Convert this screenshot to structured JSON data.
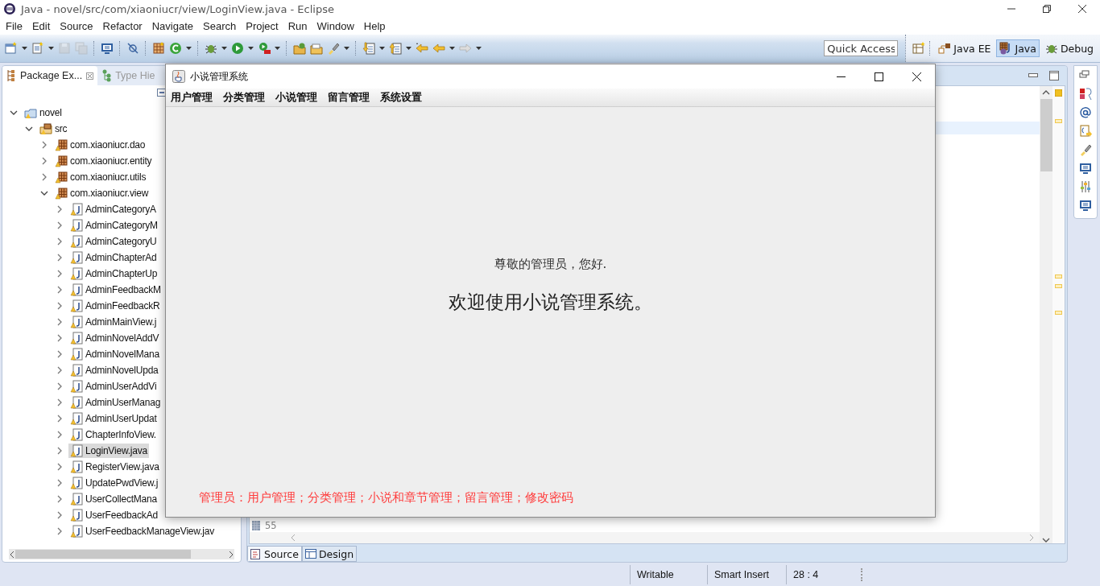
{
  "window": {
    "title": "Java - novel/src/com/xiaoniucr/view/LoginView.java - Eclipse"
  },
  "menu": [
    "File",
    "Edit",
    "Source",
    "Refactor",
    "Navigate",
    "Search",
    "Project",
    "Run",
    "Window",
    "Help"
  ],
  "toolbar": {
    "quick_access": {
      "placeholder": "Quick Access"
    },
    "perspectives": [
      {
        "label": "Java EE",
        "kind": "javaee",
        "selected": false
      },
      {
        "label": "Java",
        "kind": "java",
        "selected": true
      },
      {
        "label": "Debug",
        "kind": "debug",
        "selected": false
      }
    ]
  },
  "package_explorer": {
    "tabs": [
      {
        "label": "Package Ex...",
        "kind": "packages",
        "selected": true
      },
      {
        "label": "Type Hie",
        "kind": "hierarchy",
        "selected": false
      }
    ],
    "tree": [
      {
        "label": "novel",
        "kind": "project",
        "expanded": true,
        "selected": false,
        "children": [
          {
            "label": "src",
            "kind": "source-folder",
            "expanded": true,
            "selected": false,
            "children": [
              {
                "label": "com.xiaoniucr.dao",
                "kind": "package",
                "expanded": false,
                "selected": false
              },
              {
                "label": "com.xiaoniucr.entity",
                "kind": "package",
                "expanded": false,
                "selected": false
              },
              {
                "label": "com.xiaoniucr.utils",
                "kind": "package",
                "expanded": false,
                "selected": false
              },
              {
                "label": "com.xiaoniucr.view",
                "kind": "package",
                "expanded": true,
                "selected": false,
                "children": [
                  {
                    "label": "AdminCategoryA",
                    "kind": "file",
                    "expanded": false,
                    "selected": false
                  },
                  {
                    "label": "AdminCategoryM",
                    "kind": "file",
                    "expanded": false,
                    "selected": false
                  },
                  {
                    "label": "AdminCategoryU",
                    "kind": "file",
                    "expanded": false,
                    "selected": false
                  },
                  {
                    "label": "AdminChapterAd",
                    "kind": "file",
                    "expanded": false,
                    "selected": false
                  },
                  {
                    "label": "AdminChapterUp",
                    "kind": "file",
                    "expanded": false,
                    "selected": false
                  },
                  {
                    "label": "AdminFeedbackM",
                    "kind": "file",
                    "expanded": false,
                    "selected": false
                  },
                  {
                    "label": "AdminFeedbackR",
                    "kind": "file",
                    "expanded": false,
                    "selected": false
                  },
                  {
                    "label": "AdminMainView.j",
                    "kind": "file",
                    "expanded": false,
                    "selected": false
                  },
                  {
                    "label": "AdminNovelAddV",
                    "kind": "file",
                    "expanded": false,
                    "selected": false
                  },
                  {
                    "label": "AdminNovelMana",
                    "kind": "file",
                    "expanded": false,
                    "selected": false
                  },
                  {
                    "label": "AdminNovelUpda",
                    "kind": "file",
                    "expanded": false,
                    "selected": false
                  },
                  {
                    "label": "AdminUserAddVi",
                    "kind": "file",
                    "expanded": false,
                    "selected": false
                  },
                  {
                    "label": "AdminUserManag",
                    "kind": "file",
                    "expanded": false,
                    "selected": false
                  },
                  {
                    "label": "AdminUserUpdat",
                    "kind": "file",
                    "expanded": false,
                    "selected": false
                  },
                  {
                    "label": "ChapterInfoView.",
                    "kind": "file",
                    "expanded": false,
                    "selected": false
                  },
                  {
                    "label": "LoginView.java",
                    "kind": "file",
                    "expanded": false,
                    "selected": true
                  },
                  {
                    "label": "RegisterView.java",
                    "kind": "file",
                    "expanded": false,
                    "selected": false
                  },
                  {
                    "label": "UpdatePwdView.j",
                    "kind": "file",
                    "expanded": false,
                    "selected": false
                  },
                  {
                    "label": "UserCollectMana",
                    "kind": "file",
                    "expanded": false,
                    "selected": false
                  },
                  {
                    "label": "UserFeedbackAd",
                    "kind": "file",
                    "expanded": false,
                    "selected": false
                  },
                  {
                    "label": "UserFeedbackManageView.jav",
                    "kind": "file",
                    "expanded": false,
                    "selected": false
                  }
                ]
              }
            ]
          }
        ]
      }
    ]
  },
  "editor": {
    "line_numbers": [
      "55"
    ],
    "tabs": [
      {
        "label": "Source",
        "kind": "source",
        "selected": true
      },
      {
        "label": "Design",
        "kind": "design",
        "selected": false
      }
    ]
  },
  "status_bar": [
    "Writable",
    "Smart Insert",
    "28 : 4"
  ],
  "app_window": {
    "title": "小说管理系统",
    "menu": [
      "用户管理",
      "分类管理",
      "小说管理",
      "留言管理",
      "系统设置"
    ],
    "greeting": "尊敬的管理员，您好.",
    "welcome": "欢迎使用小说管理系统。",
    "footer": "管理员：用户管理；分类管理；小说和章节管理；留言管理；修改密码"
  }
}
